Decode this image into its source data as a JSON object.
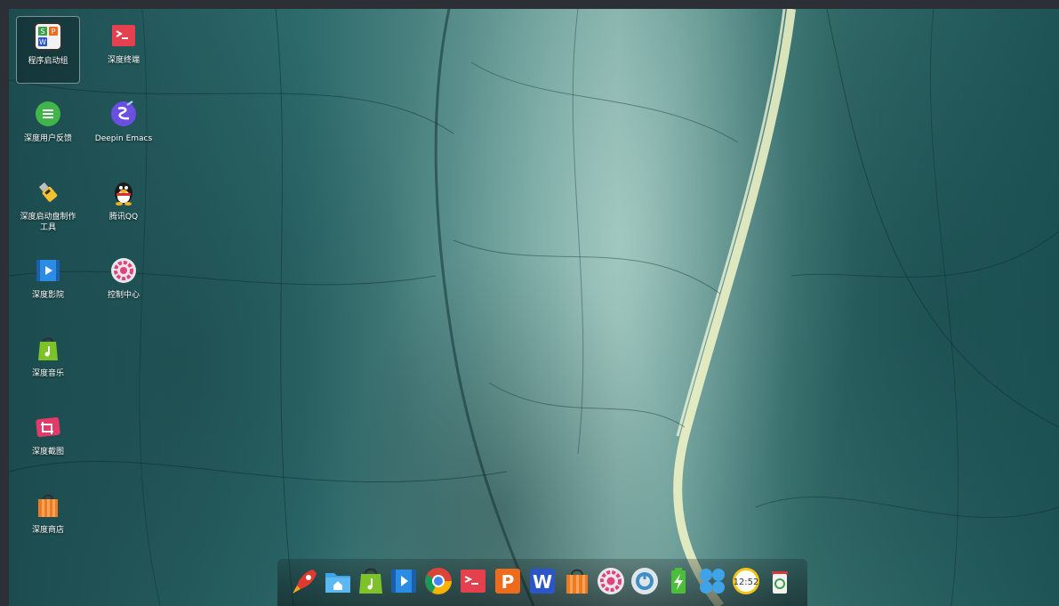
{
  "desktop": {
    "icons": [
      {
        "label": "程序启动组",
        "icon": "launcher-group-icon",
        "selected": true
      },
      {
        "label": "深度终端",
        "icon": "terminal-icon"
      },
      {
        "label": "深度用户反馈",
        "icon": "feedback-icon"
      },
      {
        "label": "Deepin Emacs",
        "icon": "emacs-icon"
      },
      {
        "label": "深度启动盘制作工具",
        "icon": "usb-boot-maker-icon"
      },
      {
        "label": "腾讯QQ",
        "icon": "qq-penguin-icon"
      },
      {
        "label": "深度影院",
        "icon": "movie-player-icon"
      },
      {
        "label": "控制中心",
        "icon": "control-center-icon"
      },
      {
        "label": "深度音乐",
        "icon": "music-icon"
      },
      {
        "label": "深度截图",
        "icon": "screenshot-icon"
      },
      {
        "label": "深度商店",
        "icon": "app-store-icon"
      }
    ],
    "launcher_group_letters": [
      "S",
      "P",
      "W"
    ],
    "qq_label": "腾讯QQ"
  },
  "dock": {
    "items": [
      "launcher-rocket-icon",
      "file-manager-icon",
      "music-player-icon",
      "movie-player-icon",
      "chrome-browser-icon",
      "terminal-icon",
      "wps-presentation-icon",
      "wps-writer-icon",
      "app-store-icon",
      "control-center-icon",
      "shutdown-icon",
      "power-battery-icon",
      "multitasking-icon",
      "clock-icon",
      "trash-icon"
    ],
    "clock_text": "12:52",
    "presentation_letter": "P",
    "writer_letter": "W"
  },
  "colors": {
    "terminal_red": "#e5404d",
    "feedback_green": "#41b44a",
    "emacs_purple": "#6a4fe0",
    "store_orange": "#f07a1f",
    "wps_blue": "#2c55c9",
    "wps_orange": "#ee6b1b"
  }
}
